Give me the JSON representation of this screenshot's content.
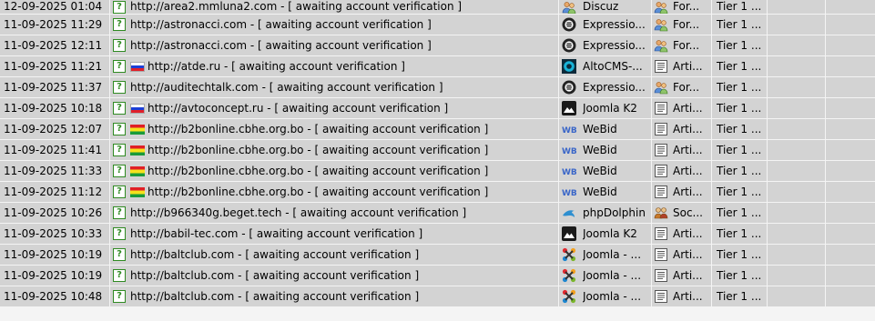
{
  "rows": [
    {
      "date": "12-09-2025 01:04",
      "status": "?",
      "flag": "",
      "url": "http://area2.mmluna2.com - [ awaiting account verification ]",
      "engine_icon": "users-icon",
      "engine": "Discuz",
      "type_icon": "users-icon",
      "type": "For...",
      "tier": "Tier 1 ..."
    },
    {
      "date": "11-09-2025 11:29",
      "status": "?",
      "flag": "",
      "url": "http://astronacci.com - [ awaiting account verification ]",
      "engine_icon": "expressionengine-icon",
      "engine": "Expressio...",
      "type_icon": "users-icon",
      "type": "For...",
      "tier": "Tier 1 ..."
    },
    {
      "date": "11-09-2025 12:11",
      "status": "?",
      "flag": "",
      "url": "http://astronacci.com - [ awaiting account verification ]",
      "engine_icon": "expressionengine-icon",
      "engine": "Expressio...",
      "type_icon": "users-icon",
      "type": "For...",
      "tier": "Tier 1 ..."
    },
    {
      "date": "11-09-2025 11:21",
      "status": "?",
      "flag": "ru",
      "url": "http://atde.ru - [ awaiting account verification ]",
      "engine_icon": "altocms-icon",
      "engine": "AltoCMS-...",
      "type_icon": "article-icon",
      "type": "Arti...",
      "tier": "Tier 1 ..."
    },
    {
      "date": "11-09-2025 11:37",
      "status": "?",
      "flag": "",
      "url": "http://auditechtalk.com - [ awaiting account verification ]",
      "engine_icon": "expressionengine-icon",
      "engine": "Expressio...",
      "type_icon": "users-icon",
      "type": "For...",
      "tier": "Tier 1 ..."
    },
    {
      "date": "11-09-2025 10:18",
      "status": "?",
      "flag": "ru",
      "url": "http://avtoconcept.ru - [ awaiting account verification ]",
      "engine_icon": "joomla-k2-icon",
      "engine": "Joomla K2",
      "type_icon": "article-icon",
      "type": "Arti...",
      "tier": "Tier 1 ..."
    },
    {
      "date": "11-09-2025 12:07",
      "status": "?",
      "flag": "bo",
      "url": "http://b2bonline.cbhe.org.bo - [ awaiting account verification ]",
      "engine_icon": "webid-icon",
      "engine": "WeBid",
      "type_icon": "article-icon",
      "type": "Arti...",
      "tier": "Tier 1 ..."
    },
    {
      "date": "11-09-2025 11:41",
      "status": "?",
      "flag": "bo",
      "url": "http://b2bonline.cbhe.org.bo - [ awaiting account verification ]",
      "engine_icon": "webid-icon",
      "engine": "WeBid",
      "type_icon": "article-icon",
      "type": "Arti...",
      "tier": "Tier 1 ..."
    },
    {
      "date": "11-09-2025 11:33",
      "status": "?",
      "flag": "bo",
      "url": "http://b2bonline.cbhe.org.bo - [ awaiting account verification ]",
      "engine_icon": "webid-icon",
      "engine": "WeBid",
      "type_icon": "article-icon",
      "type": "Arti...",
      "tier": "Tier 1 ..."
    },
    {
      "date": "11-09-2025 11:12",
      "status": "?",
      "flag": "bo",
      "url": "http://b2bonline.cbhe.org.bo - [ awaiting account verification ]",
      "engine_icon": "webid-icon",
      "engine": "WeBid",
      "type_icon": "article-icon",
      "type": "Arti...",
      "tier": "Tier 1 ..."
    },
    {
      "date": "11-09-2025 10:26",
      "status": "?",
      "flag": "",
      "url": "http://b966340g.beget.tech - [ awaiting account verification ]",
      "engine_icon": "phpdolphin-icon",
      "engine": "phpDolphin",
      "type_icon": "social-icon",
      "type": "Soc...",
      "tier": "Tier 1 ..."
    },
    {
      "date": "11-09-2025 10:33",
      "status": "?",
      "flag": "",
      "url": "http://babil-tec.com - [ awaiting account verification ]",
      "engine_icon": "joomla-k2-icon",
      "engine": "Joomla K2",
      "type_icon": "article-icon",
      "type": "Arti...",
      "tier": "Tier 1 ..."
    },
    {
      "date": "11-09-2025 10:19",
      "status": "?",
      "flag": "",
      "url": "http://baltclub.com - [ awaiting account verification ]",
      "engine_icon": "joomla-icon",
      "engine": "Joomla - ...",
      "type_icon": "article-icon",
      "type": "Arti...",
      "tier": "Tier 1 ..."
    },
    {
      "date": "11-09-2025 10:19",
      "status": "?",
      "flag": "",
      "url": "http://baltclub.com - [ awaiting account verification ]",
      "engine_icon": "joomla-icon",
      "engine": "Joomla - ...",
      "type_icon": "article-icon",
      "type": "Arti...",
      "tier": "Tier 1 ..."
    },
    {
      "date": "11-09-2025 10:48",
      "status": "?",
      "flag": "",
      "url": "http://baltclub.com - [ awaiting account verification ]",
      "engine_icon": "joomla-icon",
      "engine": "Joomla - ...",
      "type_icon": "article-icon",
      "type": "Arti...",
      "tier": "Tier 1 ..."
    }
  ],
  "colors": {
    "row_bg": "#d3d3d3",
    "grid_line": "#f4f4f4",
    "status_green": "#2f8a22"
  }
}
